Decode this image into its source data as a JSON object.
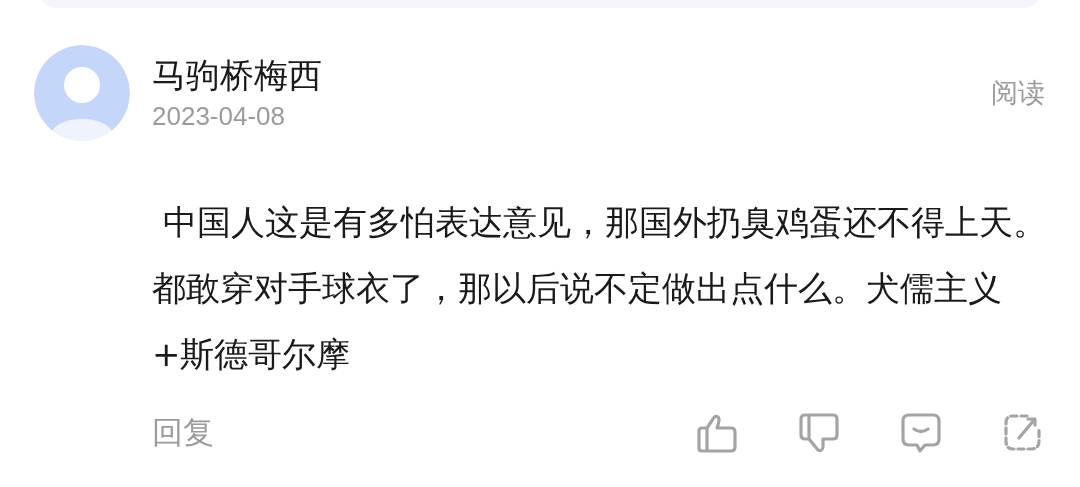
{
  "comment": {
    "author": "马驹桥梅西",
    "date": "2023-04-08",
    "read_label": "阅读",
    "text": " 中国人这是有多怕表达意见，那国外扔臭鸡蛋还不得上天。都敢穿对手球衣了，那以后说不定做出点什么。犬儒主义+斯德哥尔摩",
    "reply_label": "回复"
  },
  "actions": [
    {
      "kind": "like"
    },
    {
      "kind": "dislike"
    },
    {
      "kind": "comment"
    },
    {
      "kind": "share"
    }
  ]
}
